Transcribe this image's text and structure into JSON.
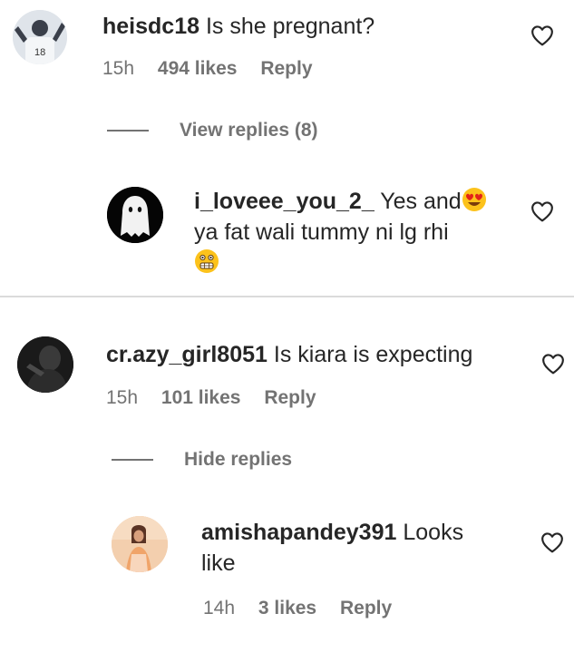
{
  "comments": [
    {
      "username": "heisdc18",
      "text": "Is she pregnant?",
      "time": "15h",
      "likes": "494 likes",
      "reply_label": "Reply",
      "thread_toggle": "View replies (8)",
      "replies": [
        {
          "username": "i_loveee_you_2_",
          "text_line1": "Yes and",
          "text_line2": "ya fat wali tummy ni lg rhi",
          "emojis": [
            "heart-eyes-emoji",
            "grimacing-emoji"
          ]
        }
      ]
    },
    {
      "username": "cr.azy_girl8051",
      "text": "Is kiara is expecting",
      "time": "15h",
      "likes": "101 likes",
      "reply_label": "Reply",
      "thread_toggle": "Hide replies",
      "replies": [
        {
          "username": "amishapandey391",
          "text_line1": "Looks",
          "text_line2": "like",
          "time": "14h",
          "likes": "3 likes",
          "reply_label": "Reply"
        }
      ]
    }
  ],
  "avatar_avatar_jersey_number": "18",
  "colors": {
    "text_primary": "#262626",
    "text_secondary": "#737373",
    "divider": "#dbdbdb",
    "background": "#ffffff"
  },
  "icons": [
    "heart-outline-icon"
  ]
}
